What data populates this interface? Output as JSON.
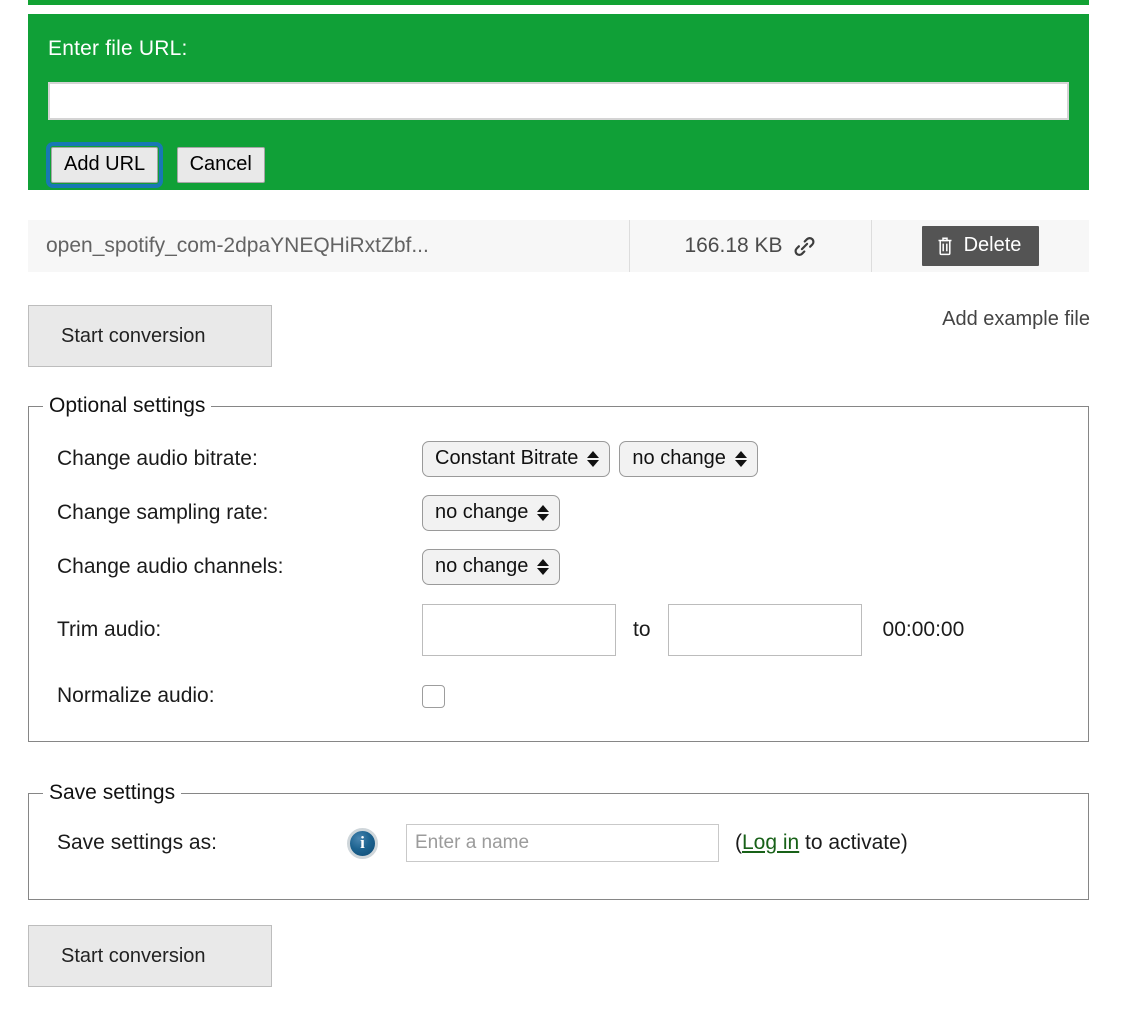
{
  "url_panel": {
    "label": "Enter file URL:",
    "input_value": "",
    "input_placeholder": "",
    "add_url_label": "Add URL",
    "cancel_label": "Cancel",
    "background_color": "#10a037"
  },
  "file_row": {
    "file_name": "open_spotify_com-2dpaYNEQHiRxtZbf...",
    "file_size": "166.18 KB",
    "link_icon": "link-icon",
    "delete_label": "Delete",
    "delete_icon": "trash-icon",
    "delete_color": "#545454"
  },
  "actions": {
    "start_conversion_top": "Start conversion",
    "add_example_file": "Add example file",
    "start_conversion_bottom": "Start conversion"
  },
  "optional_settings": {
    "legend": "Optional settings",
    "rows": [
      {
        "label": "Change audio bitrate:",
        "controls": [
          {
            "type": "select",
            "value": "Constant Bitrate"
          },
          {
            "type": "select",
            "value": "no change"
          }
        ]
      },
      {
        "label": "Change sampling rate:",
        "controls": [
          {
            "type": "select",
            "value": "no change"
          }
        ]
      },
      {
        "label": "Change audio channels:",
        "controls": [
          {
            "type": "select",
            "value": "no change"
          }
        ]
      }
    ],
    "trim": {
      "label": "Trim audio:",
      "from_value": "",
      "separator": "to",
      "to_value": "",
      "duration_readout": "00:00:00"
    },
    "normalize": {
      "label": "Normalize audio:",
      "checked": false
    }
  },
  "save_settings": {
    "legend": "Save settings",
    "label": "Save settings as:",
    "info_icon": "info-icon",
    "name_value": "",
    "name_placeholder": "Enter a name",
    "note_open": "(",
    "login_link": "Log in",
    "note_rest": " to activate)",
    "link_color": "#186118"
  }
}
